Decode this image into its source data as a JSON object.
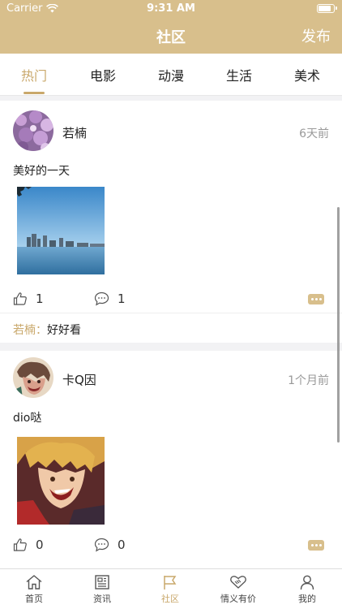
{
  "status": {
    "carrier": "Carrier",
    "time": "9:31 AM"
  },
  "nav": {
    "title": "社区",
    "publish": "发布"
  },
  "tabs": [
    {
      "label": "热门",
      "active": true
    },
    {
      "label": "电影",
      "active": false
    },
    {
      "label": "动漫",
      "active": false
    },
    {
      "label": "生活",
      "active": false
    },
    {
      "label": "美术",
      "active": false
    }
  ],
  "posts": [
    {
      "user": "若楠",
      "time": "6天前",
      "text": "美好的一天",
      "likes": "1",
      "comments": "1",
      "comment_user": "若楠",
      "comment_sep": "：",
      "comment_text": "好好看"
    },
    {
      "user": "卡Q因",
      "time": "1个月前",
      "text": "dio哒",
      "likes": "0",
      "comments": "0"
    }
  ],
  "tabbar": [
    {
      "label": "首页",
      "icon": "home-icon",
      "active": false
    },
    {
      "label": "资讯",
      "icon": "news-icon",
      "active": false
    },
    {
      "label": "社区",
      "icon": "flag-icon",
      "active": true
    },
    {
      "label": "情义有价",
      "icon": "handshake-icon",
      "active": false
    },
    {
      "label": "我的",
      "icon": "user-icon",
      "active": false
    }
  ],
  "colors": {
    "accent": "#d8bf8c",
    "accent_text": "#c9a86b"
  }
}
